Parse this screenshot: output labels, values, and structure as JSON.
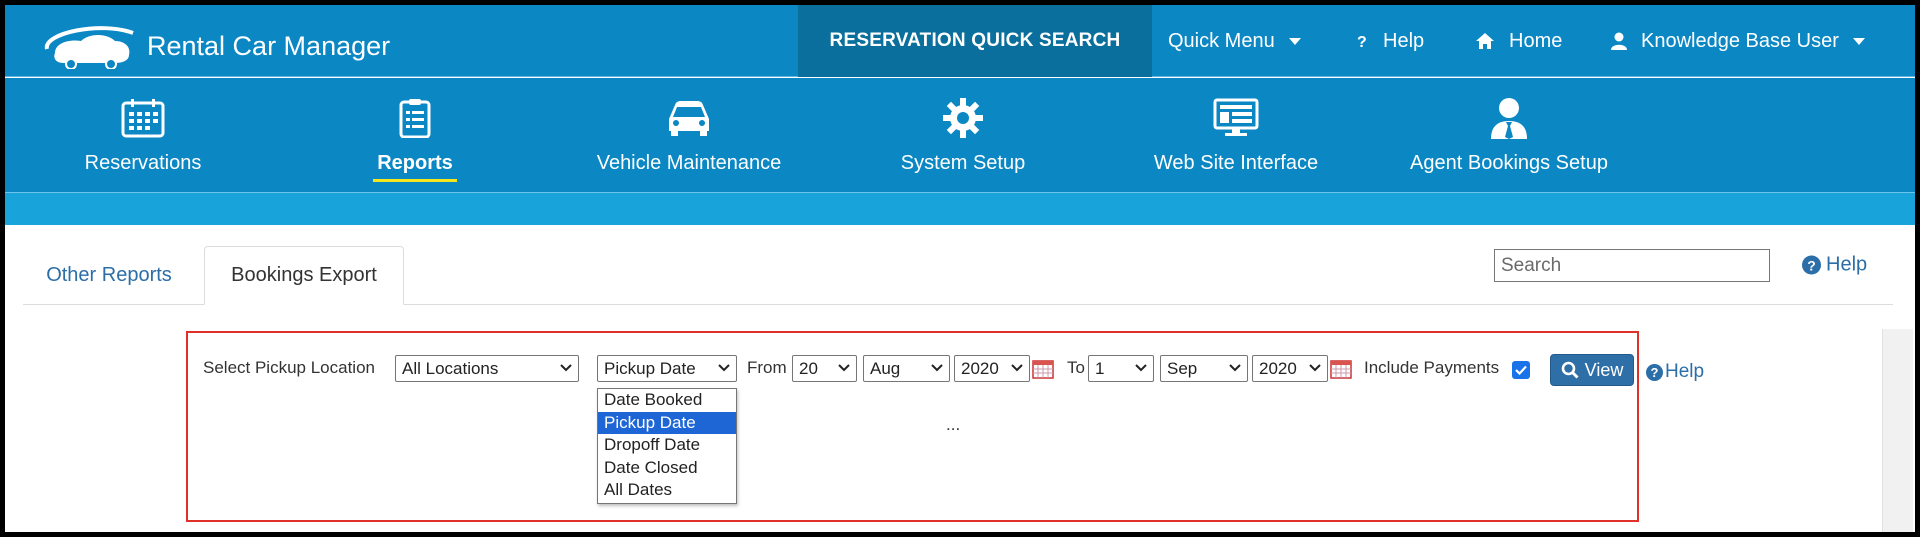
{
  "app": {
    "title": "Rental Car Manager"
  },
  "topbar": {
    "quick_search": "RESERVATION QUICK SEARCH",
    "quick_menu": "Quick Menu",
    "help": "Help",
    "home": "Home",
    "user": "Knowledge Base User"
  },
  "modules": [
    {
      "label": "Reservations",
      "icon": "calendar-icon"
    },
    {
      "label": "Reports",
      "icon": "clipboard-list-icon",
      "active": true
    },
    {
      "label": "Vehicle Maintenance",
      "icon": "car-icon"
    },
    {
      "label": "System Setup",
      "icon": "gear-icon"
    },
    {
      "label": "Web Site Interface",
      "icon": "monitor-icon"
    },
    {
      "label": "Agent Bookings Setup",
      "icon": "agent-icon"
    }
  ],
  "tabs": {
    "other_reports": "Other Reports",
    "bookings_export": "Bookings Export"
  },
  "search": {
    "placeholder": "Search"
  },
  "help_link": "Help",
  "filters": {
    "pickup_location_label": "Select Pickup Location",
    "pickup_location_value": "All Locations",
    "date_type_value": "Pickup Date",
    "from_label": "From",
    "from_day": "20",
    "from_month": "Aug",
    "from_year": "2020",
    "to_label": "To",
    "to_day": "1",
    "to_month": "Sep",
    "to_year": "2020",
    "include_payments_label": "Include Payments",
    "include_payments_checked": true,
    "view_button": "View",
    "help": "Help",
    "loading_text": "..."
  },
  "date_type_options": [
    "Date Booked",
    "Pickup Date",
    "Dropoff Date",
    "Date Closed",
    "All Dates"
  ],
  "date_type_selected": "Pickup Date",
  "colors": {
    "header_blue": "#0b87c4",
    "quick_search_bg": "#0a6f9c",
    "strip_blue": "#18a3da",
    "active_underline": "#f4e51d",
    "highlight_box": "#e0302a",
    "button_blue": "#2f6fa8",
    "link_blue": "#2b6ea8"
  }
}
